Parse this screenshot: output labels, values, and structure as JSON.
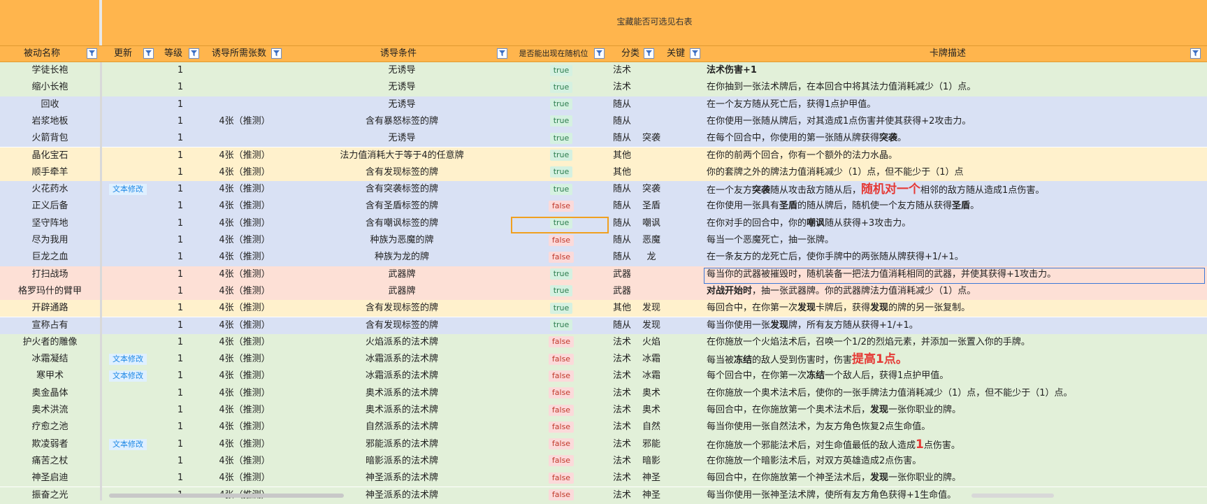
{
  "banner": {
    "title": "宝藏能否可选见右表"
  },
  "headers": {
    "name": "被动名称",
    "update": "更新",
    "level": "等级",
    "count": "诱导所需张数",
    "condition": "诱导条件",
    "random": "是否能出现在随机位",
    "category": "分类",
    "keyword": "关键",
    "description": "卡牌描述"
  },
  "colors": {
    "header": "#ffb54d",
    "green": "#e2f0d9",
    "blue": "#d9e1f4",
    "yellow": "#fff1cc",
    "pink": "#fde0d6",
    "accent_red": "#e53935"
  },
  "rows": [
    {
      "name": "学徒长袍",
      "update": "",
      "level": "1",
      "count": "",
      "condition": "无诱导",
      "random": "true",
      "category": "法术",
      "keyword": "",
      "desc": [
        {
          "t": "法术伤害+1",
          "s": "b"
        }
      ],
      "bg": "green"
    },
    {
      "name": "缩小长袍",
      "update": "",
      "level": "1",
      "count": "",
      "condition": "无诱导",
      "random": "true",
      "category": "法术",
      "keyword": "",
      "desc": [
        {
          "t": "在你抽到一张法术牌后，在本回合中将其法力值消耗减少（1）点。",
          "s": ""
        }
      ],
      "bg": "green"
    },
    {
      "name": "回收",
      "update": "",
      "level": "1",
      "count": "",
      "condition": "无诱导",
      "random": "true",
      "category": "随从",
      "keyword": "",
      "desc": [
        {
          "t": "在一个友方随从死亡后，获得1点护甲值。",
          "s": ""
        }
      ],
      "bg": "blue"
    },
    {
      "name": "岩浆地板",
      "update": "",
      "level": "1",
      "count": "4张（推测）",
      "condition": "含有暴怒标签的牌",
      "random": "true",
      "category": "随从",
      "keyword": "",
      "desc": [
        {
          "t": "在你使用一张随从牌后，对其造成1点伤害并使其获得+2攻击力。",
          "s": ""
        }
      ],
      "bg": "blue"
    },
    {
      "name": "火箭背包",
      "update": "",
      "level": "1",
      "count": "",
      "condition": "无诱导",
      "random": "true",
      "category": "随从",
      "keyword": "突袭",
      "desc": [
        {
          "t": "在每个回合中，你使用的第一张随从牌获得",
          "s": ""
        },
        {
          "t": "突袭",
          "s": "b"
        },
        {
          "t": "。",
          "s": ""
        }
      ],
      "bg": "blue"
    },
    {
      "name": "晶化宝石",
      "update": "",
      "level": "1",
      "count": "4张（推测）",
      "condition": "法力值消耗大于等于4的任意牌",
      "random": "true",
      "category": "其他",
      "keyword": "",
      "desc": [
        {
          "t": "在你的前两个回合，你有一个额外的法力水晶。",
          "s": ""
        }
      ],
      "bg": "yellow"
    },
    {
      "name": "顺手牵羊",
      "update": "",
      "level": "1",
      "count": "4张（推测）",
      "condition": "含有发现标签的牌",
      "random": "true",
      "category": "其他",
      "keyword": "",
      "desc": [
        {
          "t": "你的套牌之外的牌法力值消耗减少（1）点，但不能少于（1）点",
          "s": ""
        }
      ],
      "bg": "yellow"
    },
    {
      "name": "火花药水",
      "update": "文本修改",
      "level": "1",
      "count": "4张（推测）",
      "condition": "含有突袭标签的牌",
      "random": "true",
      "category": "随从",
      "keyword": "突袭",
      "desc": [
        {
          "t": "在一个友方",
          "s": ""
        },
        {
          "t": "突袭",
          "s": "b"
        },
        {
          "t": "随从攻击敌方随从后，",
          "s": ""
        },
        {
          "t": "随机对一个",
          "s": "r"
        },
        {
          "t": "相邻的敌方随从造成1点伤害。",
          "s": ""
        }
      ],
      "bg": "blue"
    },
    {
      "name": "正义后备",
      "update": "",
      "level": "1",
      "count": "4张（推测）",
      "condition": "含有圣盾标签的牌",
      "random": "false",
      "category": "随从",
      "keyword": "圣盾",
      "desc": [
        {
          "t": "在你使用一张具有",
          "s": ""
        },
        {
          "t": "圣盾",
          "s": "b"
        },
        {
          "t": "的随从牌后，随机使一个友方随从获得",
          "s": ""
        },
        {
          "t": "圣盾",
          "s": "b"
        },
        {
          "t": "。",
          "s": ""
        }
      ],
      "bg": "blue"
    },
    {
      "name": "坚守阵地",
      "update": "",
      "level": "1",
      "count": "4张（推测）",
      "condition": "含有嘲讽标签的牌",
      "random": "true",
      "category": "随从",
      "keyword": "嘲讽",
      "desc": [
        {
          "t": "在你对手的回合中，你的",
          "s": ""
        },
        {
          "t": "嘲讽",
          "s": "b"
        },
        {
          "t": "随从获得+3攻击力。",
          "s": ""
        }
      ],
      "bg": "blue"
    },
    {
      "name": "尽为我用",
      "update": "",
      "level": "1",
      "count": "4张（推测）",
      "condition": "种族为恶魔的牌",
      "random": "false",
      "category": "随从",
      "keyword": "恶魔",
      "desc": [
        {
          "t": "每当一个恶魔死亡，抽一张牌。",
          "s": ""
        }
      ],
      "bg": "blue"
    },
    {
      "name": "巨龙之血",
      "update": "",
      "level": "1",
      "count": "4张（推测）",
      "condition": "种族为龙的牌",
      "random": "false",
      "category": "随从",
      "keyword": "龙",
      "desc": [
        {
          "t": "在一条友方的龙死亡后，使你手牌中的两张随从牌获得+1/+1。",
          "s": ""
        }
      ],
      "bg": "blue"
    },
    {
      "name": "打扫战场",
      "update": "",
      "level": "1",
      "count": "4张（推测）",
      "condition": "武器牌",
      "random": "true",
      "category": "武器",
      "keyword": "",
      "desc": [
        {
          "t": "每当你的武器被摧毁时，随机装备一把法力值消耗相同的武器，并使其获得+1攻击力。",
          "s": ""
        }
      ],
      "bg": "pink"
    },
    {
      "name": "格罗玛什的臂甲",
      "update": "",
      "level": "1",
      "count": "4张（推测）",
      "condition": "武器牌",
      "random": "true",
      "category": "武器",
      "keyword": "",
      "desc": [
        {
          "t": "对战开始时",
          "s": "b"
        },
        {
          "t": "，抽一张武器牌。你的武器牌法力值消耗减少（1）点。",
          "s": ""
        }
      ],
      "bg": "pink"
    },
    {
      "name": "开辟通路",
      "update": "",
      "level": "1",
      "count": "4张（推测）",
      "condition": "含有发现标签的牌",
      "random": "true",
      "category": "其他",
      "keyword": "发现",
      "desc": [
        {
          "t": "每回合中，在你第一次",
          "s": ""
        },
        {
          "t": "发现",
          "s": "b"
        },
        {
          "t": "卡牌后，获得",
          "s": ""
        },
        {
          "t": "发现",
          "s": "b"
        },
        {
          "t": "的牌的另一张复制。",
          "s": ""
        }
      ],
      "bg": "yellow"
    },
    {
      "name": "宣称占有",
      "update": "",
      "level": "1",
      "count": "4张（推测）",
      "condition": "含有发现标签的牌",
      "random": "true",
      "category": "随从",
      "keyword": "发现",
      "desc": [
        {
          "t": "每当你使用一张",
          "s": ""
        },
        {
          "t": "发现",
          "s": "b"
        },
        {
          "t": "牌，所有友方随从获得+1/+1。",
          "s": ""
        }
      ],
      "bg": "blue"
    },
    {
      "name": "护火者的雕像",
      "update": "",
      "level": "1",
      "count": "4张（推测）",
      "condition": "火焰派系的法术牌",
      "random": "false",
      "category": "法术",
      "keyword": "火焰",
      "desc": [
        {
          "t": "在你施放一个火焰法术后，召唤一个1/2的烈焰元素，并添加一张置入你的手牌。",
          "s": ""
        }
      ],
      "bg": "green"
    },
    {
      "name": "冰霜凝结",
      "update": "文本修改",
      "level": "1",
      "count": "4张（推测）",
      "condition": "冰霜派系的法术牌",
      "random": "false",
      "category": "法术",
      "keyword": "冰霜",
      "desc": [
        {
          "t": "每当被",
          "s": ""
        },
        {
          "t": "冻结",
          "s": "b"
        },
        {
          "t": "的敌人受到伤害时，伤害",
          "s": ""
        },
        {
          "t": "提高1点",
          "s": "r"
        },
        {
          "t": "。",
          "s": "r"
        }
      ],
      "bg": "green"
    },
    {
      "name": "寒甲术",
      "update": "文本修改",
      "level": "1",
      "count": "4张（推测）",
      "condition": "冰霜派系的法术牌",
      "random": "false",
      "category": "法术",
      "keyword": "冰霜",
      "desc": [
        {
          "t": "每个回合中，在你第一次",
          "s": ""
        },
        {
          "t": "冻结",
          "s": "b"
        },
        {
          "t": "一个敌人后，获得1点护甲值。",
          "s": ""
        }
      ],
      "bg": "green"
    },
    {
      "name": "奥金晶体",
      "update": "",
      "level": "1",
      "count": "4张（推测）",
      "condition": "奥术派系的法术牌",
      "random": "false",
      "category": "法术",
      "keyword": "奥术",
      "desc": [
        {
          "t": "在你施放一个奥术法术后，使你的一张手牌法力值消耗减少（1）点，但不能少于（1）点。",
          "s": ""
        }
      ],
      "bg": "green"
    },
    {
      "name": "奥术洪流",
      "update": "",
      "level": "1",
      "count": "4张（推测）",
      "condition": "奥术派系的法术牌",
      "random": "false",
      "category": "法术",
      "keyword": "奥术",
      "desc": [
        {
          "t": "每回合中，在你施放第一个奥术法术后，",
          "s": ""
        },
        {
          "t": "发现",
          "s": "b"
        },
        {
          "t": "一张你职业的牌。",
          "s": ""
        }
      ],
      "bg": "green"
    },
    {
      "name": "疗愈之池",
      "update": "",
      "level": "1",
      "count": "4张（推测）",
      "condition": "自然派系的法术牌",
      "random": "false",
      "category": "法术",
      "keyword": "自然",
      "desc": [
        {
          "t": "每当你使用一张自然法术，为友方角色恢复2点生命值。",
          "s": ""
        }
      ],
      "bg": "green"
    },
    {
      "name": "欺凌弱者",
      "update": "文本修改",
      "level": "1",
      "count": "4张（推测）",
      "condition": "邪能派系的法术牌",
      "random": "false",
      "category": "法术",
      "keyword": "邪能",
      "desc": [
        {
          "t": "在你施放一个邪能法术后，对生命值最低的敌人造成",
          "s": ""
        },
        {
          "t": "1",
          "s": "r"
        },
        {
          "t": "点伤害。",
          "s": ""
        }
      ],
      "bg": "green"
    },
    {
      "name": "痛苦之杖",
      "update": "",
      "level": "1",
      "count": "4张（推测）",
      "condition": "暗影派系的法术牌",
      "random": "false",
      "category": "法术",
      "keyword": "暗影",
      "desc": [
        {
          "t": "在你施放一个暗影法术后，对双方英雄造成2点伤害。",
          "s": ""
        }
      ],
      "bg": "green"
    },
    {
      "name": "神圣启迪",
      "update": "",
      "level": "1",
      "count": "4张（推测）",
      "condition": "神圣派系的法术牌",
      "random": "false",
      "category": "法术",
      "keyword": "神圣",
      "desc": [
        {
          "t": "每回合中，在你施放第一个神圣法术后，",
          "s": ""
        },
        {
          "t": "发现",
          "s": "b"
        },
        {
          "t": "一张你职业的牌。",
          "s": ""
        }
      ],
      "bg": "green"
    },
    {
      "name": "振奋之光",
      "update": "",
      "level": "1",
      "count": "4张（推测）",
      "condition": "神圣派系的法术牌",
      "random": "false",
      "category": "法术",
      "keyword": "神圣",
      "desc": [
        {
          "t": "每当你使用一张神圣法术牌，使所有友方角色获得+1生命值。",
          "s": ""
        }
      ],
      "bg": "green"
    }
  ]
}
